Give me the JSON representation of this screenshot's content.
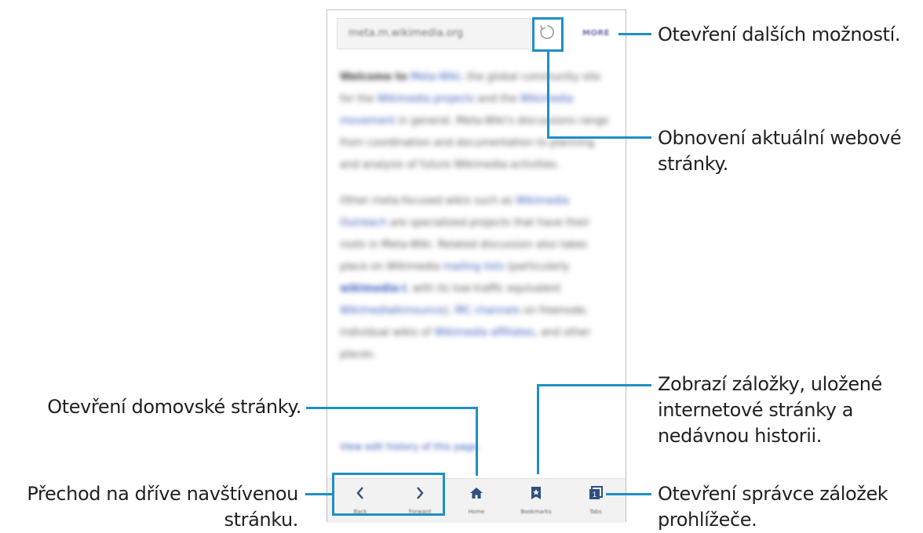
{
  "browser": {
    "url": "meta.m.wikimedia.org",
    "more_label": "MORE",
    "paragraph1": {
      "welcome_bold": "Welcome to",
      "meta_link": "Meta-Wiki",
      "t1": ", the global community site for the ",
      "projects_link": "Wikimedia projects",
      "t2": " and the ",
      "movement_link": "Wikimedia movement",
      "t3": " in general. Meta-Wiki's discussions range from coordination and documentation to planning and analysis of future Wikimedia activities."
    },
    "paragraph2": {
      "t1": "Other meta-focused wikis such as ",
      "outreach_link": "Wikimedia Outreach",
      "t2": " are specialized projects that have their roots in Meta-Wiki. Related discussion also takes place on Wikimedia ",
      "mailing_link": "mailing lists",
      "t3": " (particularly ",
      "wikimedia_l_link": "wikimedia-l",
      "t4": ", with its low-traffic equivalent ",
      "announce_link": "WikimediaAnnounce",
      "t5": "), ",
      "irc_link": "IRC channels",
      "t6": " on freenode, individual wikis of ",
      "affiliates_link": "Wikimedia affiliates",
      "t7": ", and other places."
    },
    "history_link": "View edit history of this page.",
    "toolbar": {
      "back_label": "Back",
      "forward_label": "Forward",
      "home_label": "Home",
      "bookmarks_label": "Bookmarks",
      "tabs_label": "Tabs",
      "tabs_count": "1"
    }
  },
  "callouts": {
    "more_options": "Otevření dalších možností.",
    "refresh_line1": "Obnovení aktuální webové",
    "refresh_line2": "stránky.",
    "bookmarks_line1": "Zobrazí záložky, uložené",
    "bookmarks_line2": "internetové stránky a",
    "bookmarks_line3": "nedávnou historii.",
    "tabs_line1": "Otevření správce záložek",
    "tabs_line2": "prohlížeče.",
    "home": "Otevření domovské stránky.",
    "back_forward_line1": "Přechod na dříve navštívenou",
    "back_forward_line2": "stránku."
  },
  "colors": {
    "accent": "#1f8fc4",
    "icon": "#2f4f7f",
    "link": "#3556b8"
  }
}
